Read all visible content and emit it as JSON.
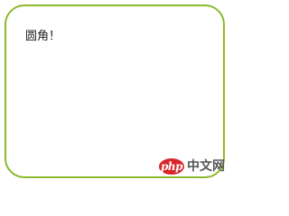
{
  "box": {
    "text": "圆角！",
    "border_color": "#8ab92d"
  },
  "watermark": {
    "logo_text": "php",
    "site_text": "中文网",
    "logo_color": "#d62629"
  }
}
